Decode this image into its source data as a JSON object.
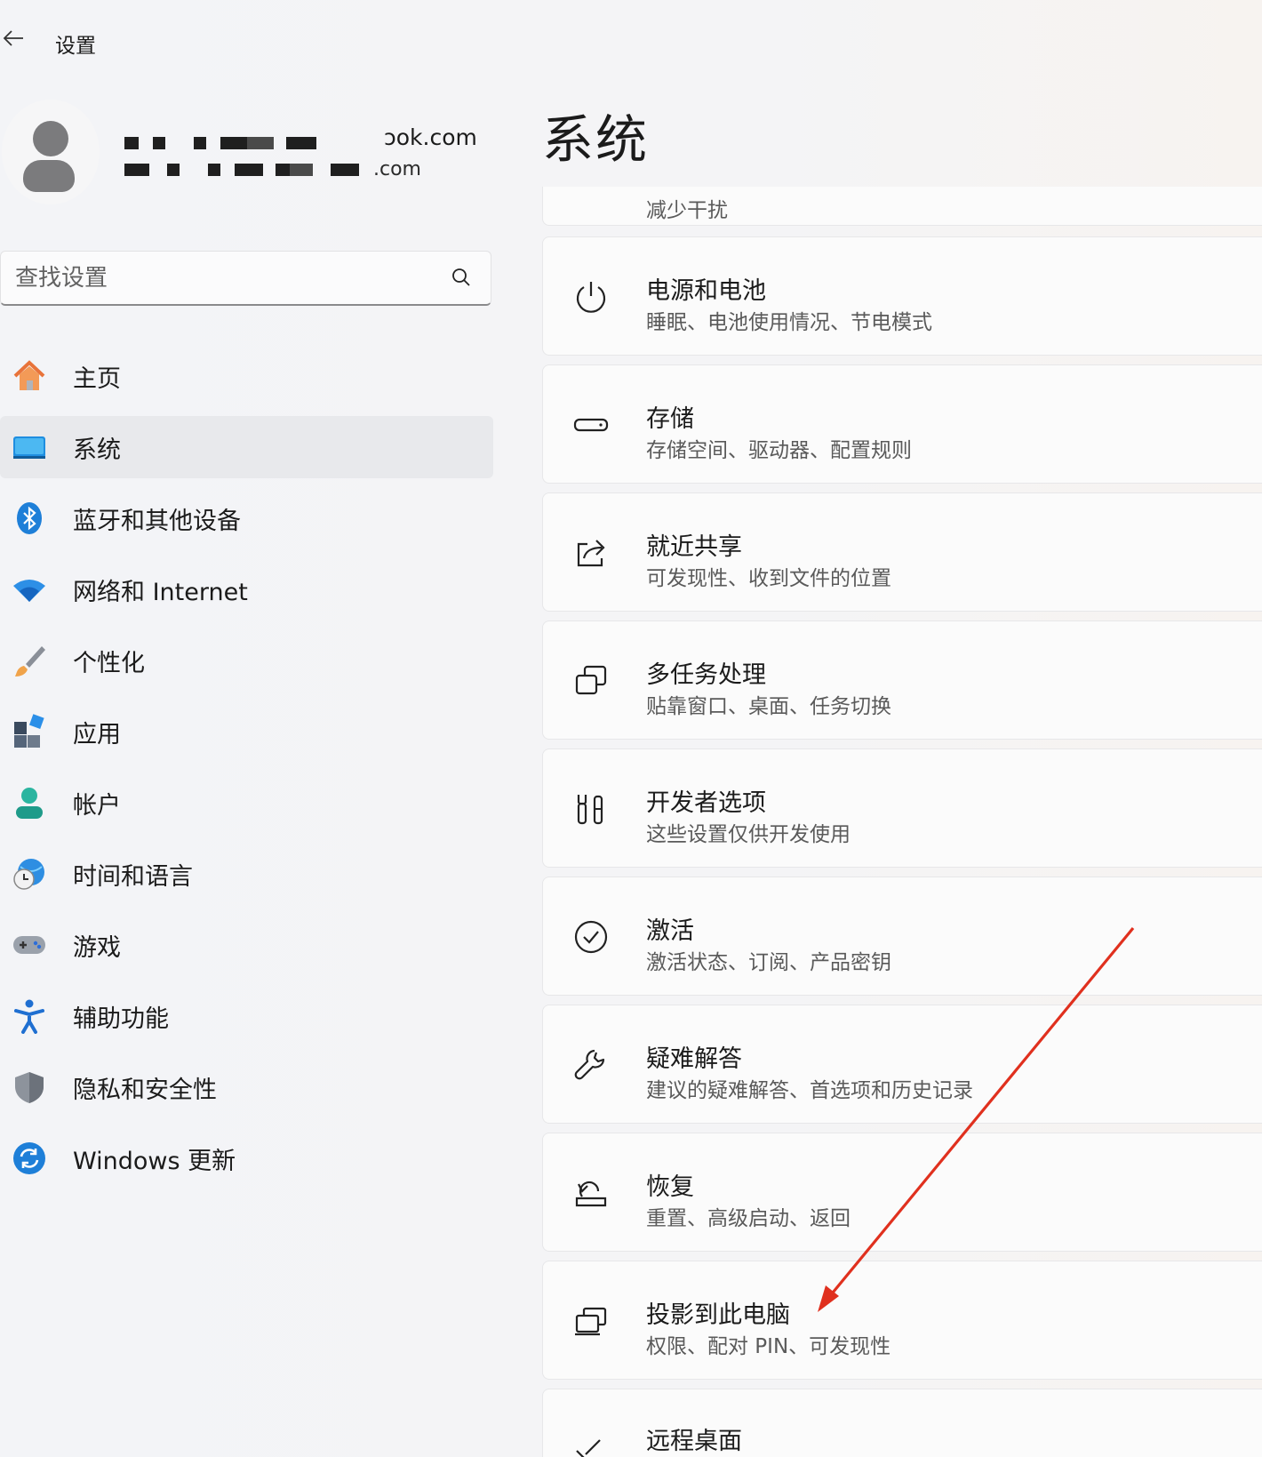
{
  "header": {
    "back_label": "←",
    "app_title": "设置"
  },
  "profile": {
    "email_line1": "ɔok.com",
    "email_line2": ".com"
  },
  "search": {
    "placeholder": "查找设置"
  },
  "sidebar": {
    "items": [
      {
        "label": "主页",
        "icon": "home-icon"
      },
      {
        "label": "系统",
        "icon": "system-icon",
        "active": true
      },
      {
        "label": "蓝牙和其他设备",
        "icon": "bluetooth-icon"
      },
      {
        "label": "网络和 Internet",
        "icon": "wifi-icon"
      },
      {
        "label": "个性化",
        "icon": "brush-icon"
      },
      {
        "label": "应用",
        "icon": "apps-icon"
      },
      {
        "label": "帐户",
        "icon": "account-icon"
      },
      {
        "label": "时间和语言",
        "icon": "globe-clock-icon"
      },
      {
        "label": "游戏",
        "icon": "gamepad-icon"
      },
      {
        "label": "辅助功能",
        "icon": "accessibility-icon"
      },
      {
        "label": "隐私和安全性",
        "icon": "shield-icon"
      },
      {
        "label": "Windows 更新",
        "icon": "update-icon"
      }
    ]
  },
  "main": {
    "title": "系统",
    "partial_top_subtitle": "减少干扰",
    "cards": [
      {
        "title": "电源和电池",
        "subtitle": "睡眠、电池使用情况、节电模式",
        "icon": "power-icon"
      },
      {
        "title": "存储",
        "subtitle": "存储空间、驱动器、配置规则",
        "icon": "storage-icon"
      },
      {
        "title": "就近共享",
        "subtitle": "可发现性、收到文件的位置",
        "icon": "share-icon"
      },
      {
        "title": "多任务处理",
        "subtitle": "贴靠窗口、桌面、任务切换",
        "icon": "multitask-icon"
      },
      {
        "title": "开发者选项",
        "subtitle": "这些设置仅供开发使用",
        "icon": "developer-tools-icon"
      },
      {
        "title": "激活",
        "subtitle": "激活状态、订阅、产品密钥",
        "icon": "check-circle-icon"
      },
      {
        "title": "疑难解答",
        "subtitle": "建议的疑难解答、首选项和历史记录",
        "icon": "wrench-icon"
      },
      {
        "title": "恢复",
        "subtitle": "重置、高级启动、返回",
        "icon": "recovery-icon"
      },
      {
        "title": "投影到此电脑",
        "subtitle": "权限、配对 PIN、可发现性",
        "icon": "project-icon"
      },
      {
        "title": "远程桌面",
        "subtitle": "",
        "icon": "remote-desktop-icon"
      }
    ]
  },
  "annotation": {
    "arrow_color": "#e0301e"
  }
}
